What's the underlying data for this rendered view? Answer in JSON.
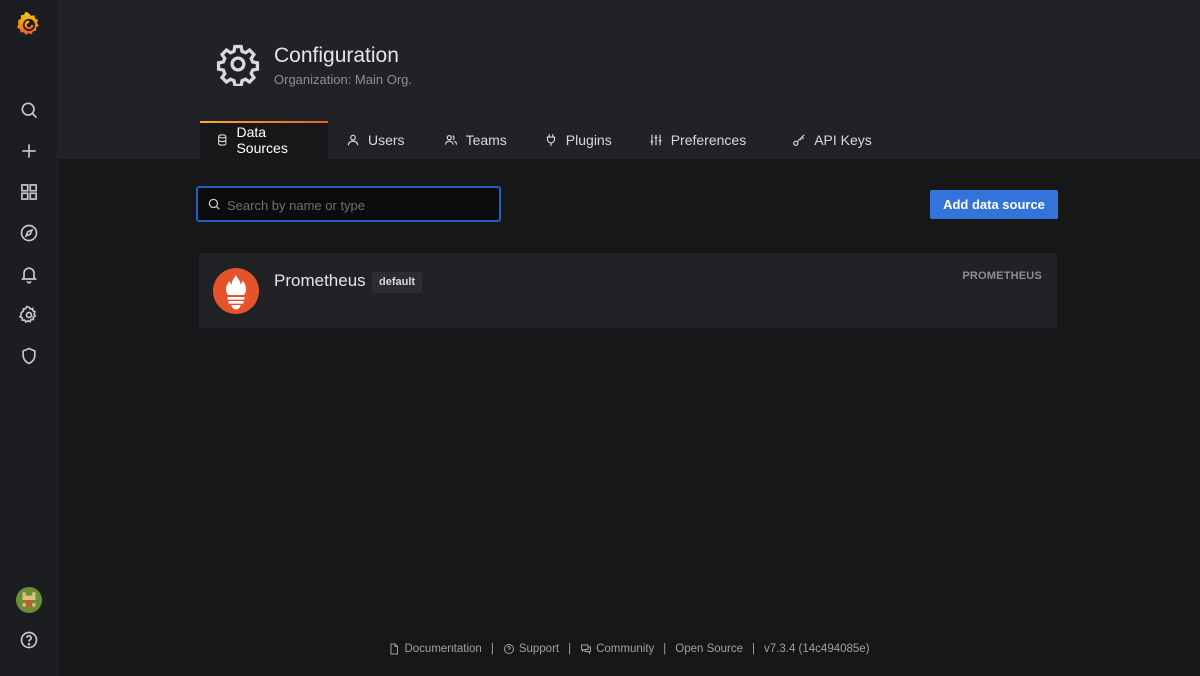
{
  "header": {
    "title": "Configuration",
    "subtitle": "Organization: Main Org."
  },
  "tabs": [
    {
      "label": "Data Sources",
      "icon": "database-icon",
      "active": true
    },
    {
      "label": "Users",
      "icon": "user-icon",
      "active": false
    },
    {
      "label": "Teams",
      "icon": "users-icon",
      "active": false
    },
    {
      "label": "Plugins",
      "icon": "plug-icon",
      "active": false
    },
    {
      "label": "Preferences",
      "icon": "sliders-icon",
      "active": false
    },
    {
      "label": "API Keys",
      "icon": "key-icon",
      "active": false
    }
  ],
  "search": {
    "placeholder": "Search by name or type",
    "value": ""
  },
  "add_button": "Add data source",
  "datasources": [
    {
      "name": "Prometheus",
      "badge": "default",
      "type": "PROMETHEUS"
    }
  ],
  "footer": {
    "documentation": "Documentation",
    "support": "Support",
    "community": "Community",
    "open_source": "Open Source",
    "version": "v7.3.4 (14c494085e)",
    "separator": "|"
  },
  "colors": {
    "accent": "#3274d9",
    "brand_orange": "#f05a28",
    "prometheus": "#e6522c"
  }
}
